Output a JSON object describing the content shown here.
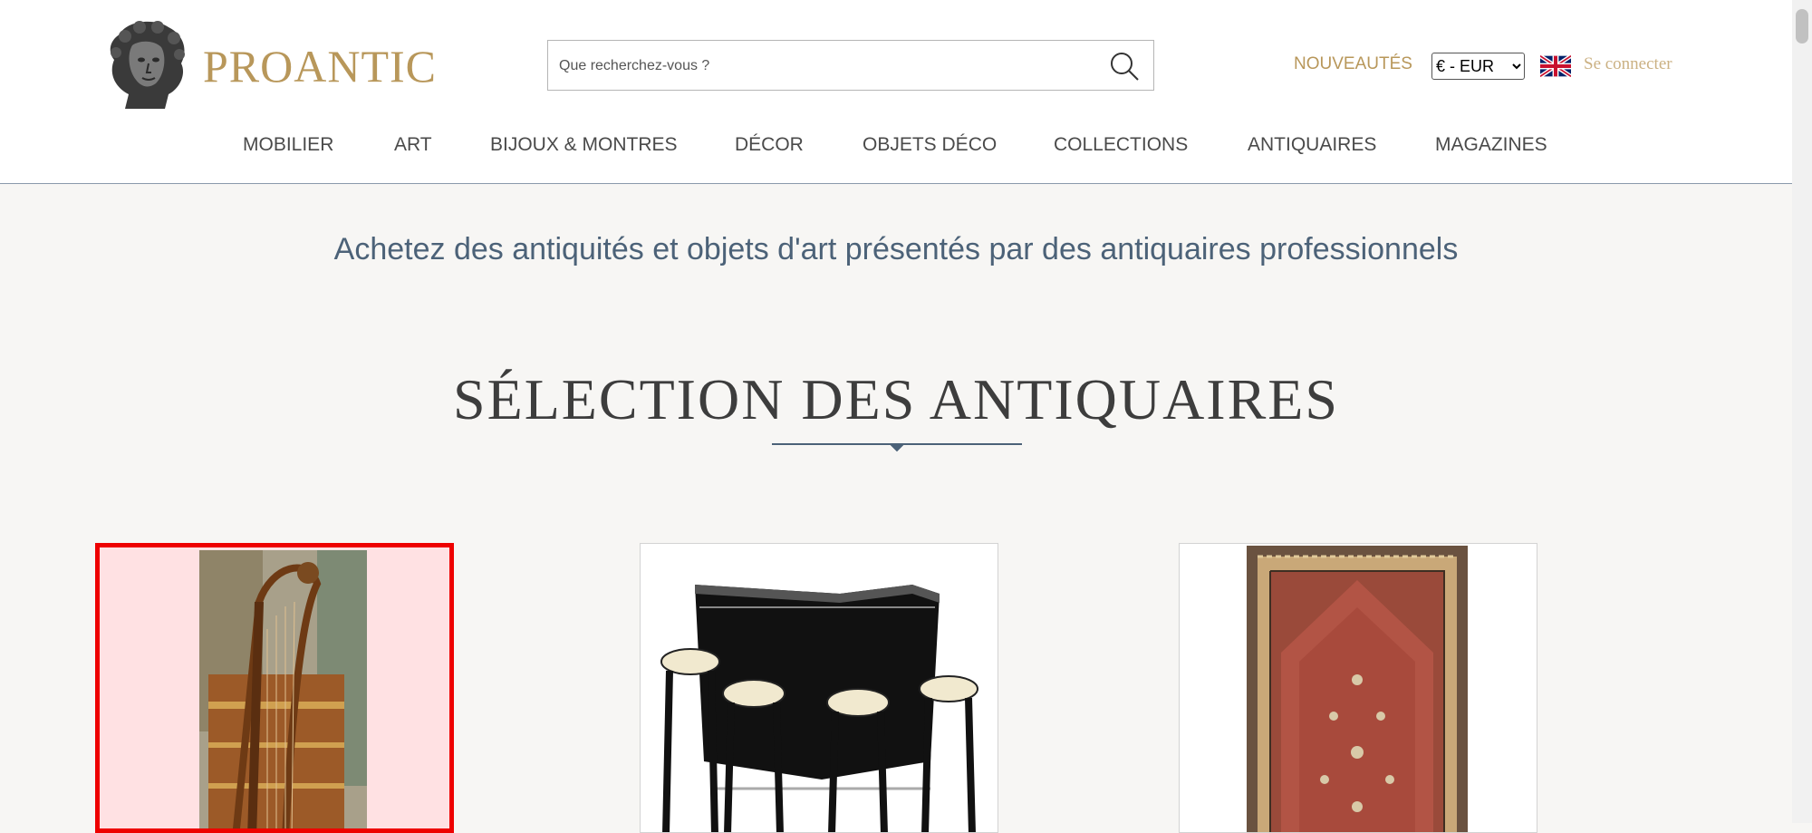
{
  "brand": {
    "name": "PROANTIC"
  },
  "search": {
    "placeholder": "Que recherchez-vous ?"
  },
  "header": {
    "new_label": "NOUVEAUTÉS",
    "currency_selected": "€ - EUR",
    "login_label": "Se connecter",
    "language_icon": "uk-flag-icon"
  },
  "nav": {
    "items": [
      {
        "label": "MOBILIER"
      },
      {
        "label": "ART"
      },
      {
        "label": "BIJOUX & MONTRES"
      },
      {
        "label": "DÉCOR"
      },
      {
        "label": "OBJETS DÉCO"
      },
      {
        "label": "COLLECTIONS"
      },
      {
        "label": "ANTIQUAIRES"
      },
      {
        "label": "MAGAZINES"
      }
    ]
  },
  "main": {
    "tagline": "Achetez des antiquités et objets d'art présentés par des antiquaires professionnels",
    "section_title": "SÉLECTION DES ANTIQUAIRES"
  },
  "colors": {
    "brand_gold": "#b8975a",
    "accent_blue": "#4c6278",
    "selection_red": "#ee0000"
  }
}
